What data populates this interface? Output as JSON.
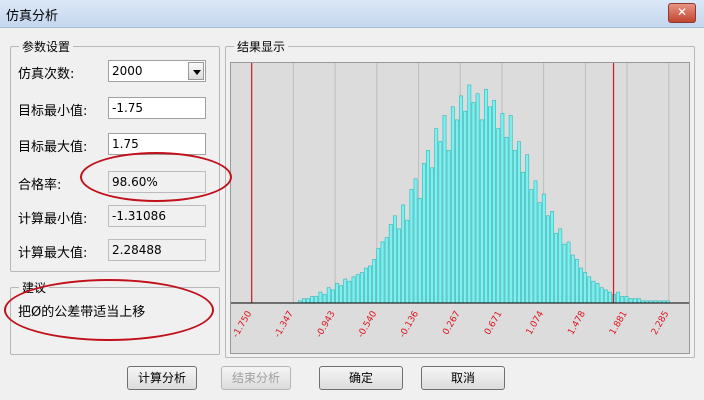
{
  "window": {
    "title": "仿真分析",
    "close_icon": "close-icon"
  },
  "params": {
    "legend": "参数设置",
    "sim_count_label": "仿真次数:",
    "sim_count_value": "2000",
    "target_min_label": "目标最小值:",
    "target_min_value": "-1.75",
    "target_max_label": "目标最大值:",
    "target_max_value": "1.75",
    "pass_rate_label": "合格率:",
    "pass_rate_value": "98.60%",
    "calc_min_label": "计算最小值:",
    "calc_min_value": "-1.31086",
    "calc_max_label": "计算最大值:",
    "calc_max_value": "2.28488"
  },
  "suggestion": {
    "legend": "建议",
    "text": "把Ø的公差带适当上移"
  },
  "result": {
    "legend": "结果显示"
  },
  "buttons": {
    "calc": "计算分析",
    "stop": "结束分析",
    "ok": "确定",
    "cancel": "取消"
  },
  "colors": {
    "bar": "#7ff0f0",
    "bar_edge": "#2ab6b6",
    "limit": "#e0141e",
    "tick_text": "#e0141e",
    "annotation": "#c0101a"
  },
  "chart_data": {
    "type": "bar",
    "x_ticks": [
      "-1.750",
      "-1.347",
      "-0.943",
      "-0.540",
      "-0.136",
      "0.267",
      "0.671",
      "1.074",
      "1.478",
      "1.881",
      "2.285"
    ],
    "limits": [
      -1.75,
      1.75
    ],
    "xlim": [
      -1.95,
      2.48
    ],
    "ylim": [
      0,
      1
    ],
    "grid": true,
    "bins": [
      {
        "x": -1.3,
        "v": 0.01
      },
      {
        "x": -1.26,
        "v": 0.02
      },
      {
        "x": -1.22,
        "v": 0.02
      },
      {
        "x": -1.18,
        "v": 0.03
      },
      {
        "x": -1.14,
        "v": 0.03
      },
      {
        "x": -1.1,
        "v": 0.05
      },
      {
        "x": -1.06,
        "v": 0.04
      },
      {
        "x": -1.02,
        "v": 0.07
      },
      {
        "x": -0.98,
        "v": 0.06
      },
      {
        "x": -0.94,
        "v": 0.09
      },
      {
        "x": -0.9,
        "v": 0.08
      },
      {
        "x": -0.86,
        "v": 0.11
      },
      {
        "x": -0.82,
        "v": 0.1
      },
      {
        "x": -0.78,
        "v": 0.12
      },
      {
        "x": -0.74,
        "v": 0.13
      },
      {
        "x": -0.7,
        "v": 0.14
      },
      {
        "x": -0.66,
        "v": 0.16
      },
      {
        "x": -0.62,
        "v": 0.17
      },
      {
        "x": -0.58,
        "v": 0.2
      },
      {
        "x": -0.54,
        "v": 0.25
      },
      {
        "x": -0.5,
        "v": 0.28
      },
      {
        "x": -0.46,
        "v": 0.3
      },
      {
        "x": -0.42,
        "v": 0.36
      },
      {
        "x": -0.38,
        "v": 0.4
      },
      {
        "x": -0.34,
        "v": 0.34
      },
      {
        "x": -0.3,
        "v": 0.45
      },
      {
        "x": -0.26,
        "v": 0.38
      },
      {
        "x": -0.22,
        "v": 0.52
      },
      {
        "x": -0.18,
        "v": 0.57
      },
      {
        "x": -0.14,
        "v": 0.48
      },
      {
        "x": -0.1,
        "v": 0.64
      },
      {
        "x": -0.06,
        "v": 0.7
      },
      {
        "x": -0.02,
        "v": 0.62
      },
      {
        "x": 0.02,
        "v": 0.8
      },
      {
        "x": 0.06,
        "v": 0.74
      },
      {
        "x": 0.1,
        "v": 0.86
      },
      {
        "x": 0.14,
        "v": 0.7
      },
      {
        "x": 0.18,
        "v": 0.9
      },
      {
        "x": 0.22,
        "v": 0.84
      },
      {
        "x": 0.26,
        "v": 0.95
      },
      {
        "x": 0.3,
        "v": 0.88
      },
      {
        "x": 0.34,
        "v": 1.0
      },
      {
        "x": 0.38,
        "v": 0.92
      },
      {
        "x": 0.42,
        "v": 0.96
      },
      {
        "x": 0.46,
        "v": 0.84
      },
      {
        "x": 0.5,
        "v": 0.98
      },
      {
        "x": 0.54,
        "v": 0.9
      },
      {
        "x": 0.58,
        "v": 0.93
      },
      {
        "x": 0.62,
        "v": 0.8
      },
      {
        "x": 0.66,
        "v": 0.87
      },
      {
        "x": 0.7,
        "v": 0.76
      },
      {
        "x": 0.74,
        "v": 0.86
      },
      {
        "x": 0.78,
        "v": 0.7
      },
      {
        "x": 0.82,
        "v": 0.74
      },
      {
        "x": 0.86,
        "v": 0.6
      },
      {
        "x": 0.9,
        "v": 0.68
      },
      {
        "x": 0.94,
        "v": 0.52
      },
      {
        "x": 0.98,
        "v": 0.56
      },
      {
        "x": 1.02,
        "v": 0.46
      },
      {
        "x": 1.06,
        "v": 0.5
      },
      {
        "x": 1.1,
        "v": 0.4
      },
      {
        "x": 1.14,
        "v": 0.42
      },
      {
        "x": 1.18,
        "v": 0.32
      },
      {
        "x": 1.22,
        "v": 0.34
      },
      {
        "x": 1.26,
        "v": 0.27
      },
      {
        "x": 1.3,
        "v": 0.28
      },
      {
        "x": 1.34,
        "v": 0.22
      },
      {
        "x": 1.38,
        "v": 0.2
      },
      {
        "x": 1.42,
        "v": 0.16
      },
      {
        "x": 1.46,
        "v": 0.14
      },
      {
        "x": 1.5,
        "v": 0.12
      },
      {
        "x": 1.54,
        "v": 0.1
      },
      {
        "x": 1.58,
        "v": 0.09
      },
      {
        "x": 1.62,
        "v": 0.07
      },
      {
        "x": 1.66,
        "v": 0.06
      },
      {
        "x": 1.7,
        "v": 0.05
      },
      {
        "x": 1.74,
        "v": 0.04
      },
      {
        "x": 1.78,
        "v": 0.05
      },
      {
        "x": 1.82,
        "v": 0.03
      },
      {
        "x": 1.86,
        "v": 0.03
      },
      {
        "x": 1.9,
        "v": 0.02
      },
      {
        "x": 1.94,
        "v": 0.02
      },
      {
        "x": 1.98,
        "v": 0.02
      },
      {
        "x": 2.02,
        "v": 0.01
      },
      {
        "x": 2.06,
        "v": 0.01
      },
      {
        "x": 2.1,
        "v": 0.01
      },
      {
        "x": 2.14,
        "v": 0.01
      },
      {
        "x": 2.18,
        "v": 0.01
      },
      {
        "x": 2.22,
        "v": 0.01
      },
      {
        "x": 2.26,
        "v": 0.01
      }
    ]
  }
}
